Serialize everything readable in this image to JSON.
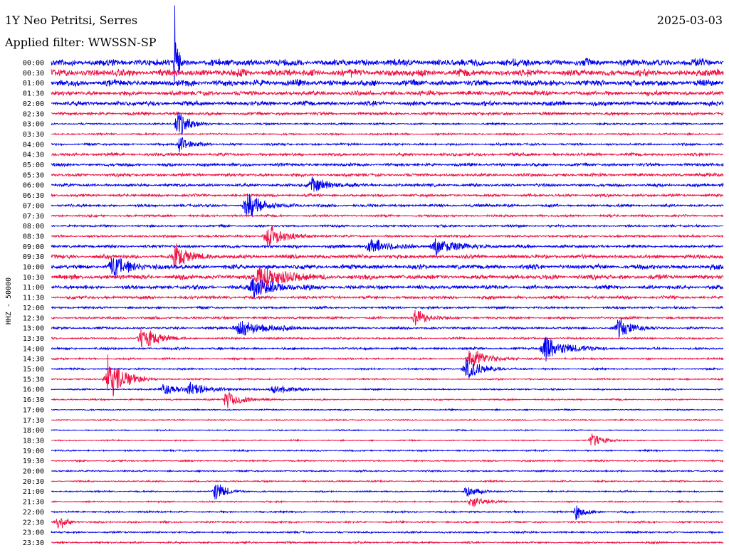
{
  "header": {
    "station": "1Y Neo Petritsi, Serres",
    "date": "2025-03-03",
    "filter_label": "Applied filter:",
    "filter": "WWSSN-SP"
  },
  "colors": {
    "trace_a": "#0000ee",
    "trace_b": "#ee1144",
    "axis": "#000000"
  },
  "chart_data": {
    "type": "line",
    "title": "1Y Neo Petritsi, Serres",
    "date": "2025-03-03",
    "ylabel": "HHZ - 50000",
    "xlabel": "",
    "x_unit": "minutes after row start",
    "xlim": [
      0,
      30
    ],
    "row_interval_min": 30,
    "grid": false,
    "rows": [
      {
        "time": "00:00",
        "noise": 4.5
      },
      {
        "time": "00:30",
        "noise": 4.5
      },
      {
        "time": "01:00",
        "noise": 4.0
      },
      {
        "time": "01:30",
        "noise": 3.0
      },
      {
        "time": "02:00",
        "noise": 3.0
      },
      {
        "time": "02:30",
        "noise": 2.0
      },
      {
        "time": "03:00",
        "noise": 1.2
      },
      {
        "time": "03:30",
        "noise": 1.2
      },
      {
        "time": "04:00",
        "noise": 1.5
      },
      {
        "time": "04:30",
        "noise": 2.0
      },
      {
        "time": "05:00",
        "noise": 2.0
      },
      {
        "time": "05:30",
        "noise": 2.0
      },
      {
        "time": "06:00",
        "noise": 2.0
      },
      {
        "time": "06:30",
        "noise": 1.8
      },
      {
        "time": "07:00",
        "noise": 1.8
      },
      {
        "time": "07:30",
        "noise": 1.5
      },
      {
        "time": "08:00",
        "noise": 1.5
      },
      {
        "time": "08:30",
        "noise": 1.5
      },
      {
        "time": "09:00",
        "noise": 2.0
      },
      {
        "time": "09:30",
        "noise": 2.5
      },
      {
        "time": "10:00",
        "noise": 3.0
      },
      {
        "time": "10:30",
        "noise": 3.0
      },
      {
        "time": "11:00",
        "noise": 2.5
      },
      {
        "time": "11:30",
        "noise": 2.0
      },
      {
        "time": "12:00",
        "noise": 1.5
      },
      {
        "time": "12:30",
        "noise": 1.5
      },
      {
        "time": "13:00",
        "noise": 1.5
      },
      {
        "time": "13:30",
        "noise": 1.2
      },
      {
        "time": "14:00",
        "noise": 1.5
      },
      {
        "time": "14:30",
        "noise": 1.2
      },
      {
        "time": "15:00",
        "noise": 1.2
      },
      {
        "time": "15:30",
        "noise": 1.0
      },
      {
        "time": "16:00",
        "noise": 1.0
      },
      {
        "time": "16:30",
        "noise": 1.0
      },
      {
        "time": "17:00",
        "noise": 0.8
      },
      {
        "time": "17:30",
        "noise": 0.8
      },
      {
        "time": "18:00",
        "noise": 0.8
      },
      {
        "time": "18:30",
        "noise": 0.8
      },
      {
        "time": "19:00",
        "noise": 1.0
      },
      {
        "time": "19:30",
        "noise": 1.0
      },
      {
        "time": "20:00",
        "noise": 1.0
      },
      {
        "time": "20:30",
        "noise": 1.0
      },
      {
        "time": "21:00",
        "noise": 1.0
      },
      {
        "time": "21:30",
        "noise": 1.0
      },
      {
        "time": "22:00",
        "noise": 1.2
      },
      {
        "time": "22:30",
        "noise": 1.2
      },
      {
        "time": "23:00",
        "noise": 1.2
      },
      {
        "time": "23:30",
        "noise": 1.2
      }
    ],
    "events": [
      {
        "row": "00:00",
        "minute": 5.5,
        "amp": 90,
        "dur": 0.3
      },
      {
        "row": "03:00",
        "minute": 5.6,
        "amp": 25,
        "dur": 1.0
      },
      {
        "row": "04:00",
        "minute": 5.7,
        "amp": 14,
        "dur": 1.0
      },
      {
        "row": "06:00",
        "minute": 11.6,
        "amp": 14,
        "dur": 1.5
      },
      {
        "row": "07:00",
        "minute": 8.7,
        "amp": 22,
        "dur": 1.5
      },
      {
        "row": "08:30",
        "minute": 9.6,
        "amp": 22,
        "dur": 1.5
      },
      {
        "row": "09:00",
        "minute": 14.2,
        "amp": 16,
        "dur": 1.5
      },
      {
        "row": "09:00",
        "minute": 17.1,
        "amp": 14,
        "dur": 2.0
      },
      {
        "row": "09:30",
        "minute": 5.5,
        "amp": 18,
        "dur": 1.5
      },
      {
        "row": "10:00",
        "minute": 2.7,
        "amp": 16,
        "dur": 2.0
      },
      {
        "row": "10:30",
        "minute": 9.3,
        "amp": 24,
        "dur": 2.0
      },
      {
        "row": "11:00",
        "minute": 9.0,
        "amp": 18,
        "dur": 2.0
      },
      {
        "row": "12:30",
        "minute": 16.2,
        "amp": 18,
        "dur": 1.0
      },
      {
        "row": "13:00",
        "minute": 8.4,
        "amp": 14,
        "dur": 2.5
      },
      {
        "row": "13:00",
        "minute": 25.3,
        "amp": 16,
        "dur": 1.5
      },
      {
        "row": "13:30",
        "minute": 4.0,
        "amp": 20,
        "dur": 1.5
      },
      {
        "row": "14:00",
        "minute": 22.0,
        "amp": 22,
        "dur": 2.0
      },
      {
        "row": "14:30",
        "minute": 18.7,
        "amp": 20,
        "dur": 1.5
      },
      {
        "row": "15:00",
        "minute": 18.5,
        "amp": 18,
        "dur": 1.5
      },
      {
        "row": "15:30",
        "minute": 2.5,
        "amp": 38,
        "dur": 1.5
      },
      {
        "row": "16:00",
        "minute": 5.0,
        "amp": 12,
        "dur": 1.5
      },
      {
        "row": "16:00",
        "minute": 6.2,
        "amp": 10,
        "dur": 2.0
      },
      {
        "row": "16:00",
        "minute": 9.9,
        "amp": 10,
        "dur": 1.5
      },
      {
        "row": "16:30",
        "minute": 7.8,
        "amp": 16,
        "dur": 1.5
      },
      {
        "row": "18:30",
        "minute": 24.1,
        "amp": 14,
        "dur": 1.0
      },
      {
        "row": "21:00",
        "minute": 7.3,
        "amp": 18,
        "dur": 1.0
      },
      {
        "row": "21:00",
        "minute": 18.5,
        "amp": 12,
        "dur": 1.0
      },
      {
        "row": "21:30",
        "minute": 18.7,
        "amp": 12,
        "dur": 1.0
      },
      {
        "row": "22:00",
        "minute": 23.4,
        "amp": 14,
        "dur": 0.8
      },
      {
        "row": "22:30",
        "minute": 0.3,
        "amp": 14,
        "dur": 0.8
      }
    ]
  }
}
